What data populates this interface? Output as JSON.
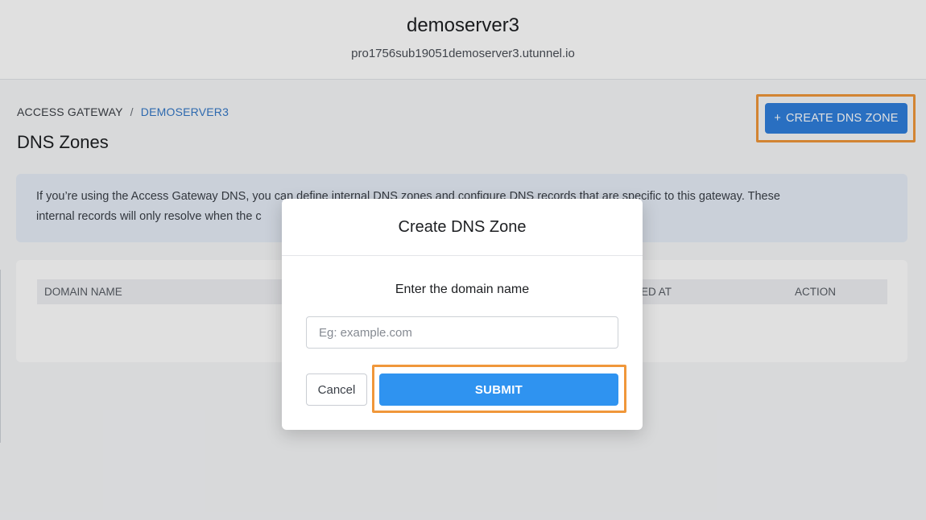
{
  "header": {
    "server_name": "demoserver3",
    "server_host": "pro1756sub19051demoserver3.utunnel.io"
  },
  "breadcrumb": {
    "root": "ACCESS GATEWAY",
    "separator": "/",
    "current": "DEMOSERVER3"
  },
  "page": {
    "title": "DNS Zones",
    "create_button_icon": "+",
    "create_button_label": "CREATE DNS ZONE",
    "info_line_1": "If you’re using the Access Gateway DNS, you can define internal DNS zones and configure DNS records that are specific to this gateway. These",
    "info_line_2": "internal records will only resolve when the c"
  },
  "table": {
    "columns": {
      "domain_name": "DOMAIN NAME",
      "created_at": "ED AT",
      "action": "ACTION"
    }
  },
  "modal": {
    "title": "Create DNS Zone",
    "label": "Enter the domain name",
    "input_value": "",
    "input_placeholder": "Eg: example.com",
    "cancel_label": "Cancel",
    "submit_label": "SUBMIT"
  },
  "colors": {
    "primary": "#2f7fdc",
    "submit": "#2f93f0",
    "highlight": "#f0973a",
    "info_bg": "#e6edf7"
  }
}
